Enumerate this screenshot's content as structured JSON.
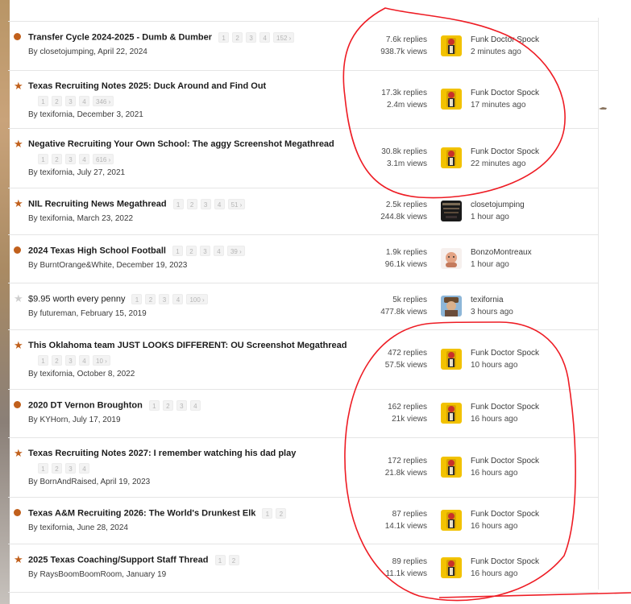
{
  "threads": [
    {
      "title": "Transfer Cycle 2024-2025 - Dumb & Dumber",
      "pages": [
        "1",
        "2",
        "3",
        "4",
        "152 ›"
      ],
      "byline": "By closetojumping, April 22, 2024",
      "replies": "7.6k replies",
      "views": "938.7k views",
      "last_user": "Funk Doctor Spock",
      "last_time": "2 minutes ago",
      "status": "dot"
    },
    {
      "title": "Texas Recruiting Notes 2025: Duck Around and Find Out",
      "pages": [
        "1",
        "2",
        "3",
        "4",
        "346 ›"
      ],
      "byline": "By texifornia, December 3, 2021",
      "replies": "17.3k replies",
      "views": "2.4m views",
      "last_user": "Funk Doctor Spock",
      "last_time": "17 minutes ago",
      "status": "star"
    },
    {
      "title": "Negative Recruiting Your Own School: The aggy Screenshot Megathread",
      "pages": [
        "1",
        "2",
        "3",
        "4",
        "616 ›"
      ],
      "byline": "By texifornia, July 27, 2021",
      "replies": "30.8k replies",
      "views": "3.1m views",
      "last_user": "Funk Doctor Spock",
      "last_time": "22 minutes ago",
      "status": "star"
    },
    {
      "title": "NIL Recruiting News Megathread",
      "pages": [
        "1",
        "2",
        "3",
        "4",
        "51 ›"
      ],
      "byline": "By texifornia, March 23, 2022",
      "replies": "2.5k replies",
      "views": "244.8k views",
      "last_user": "closetojumping",
      "last_time": "1 hour ago",
      "status": "star"
    },
    {
      "title": "2024 Texas High School Football",
      "pages": [
        "1",
        "2",
        "3",
        "4",
        "39 ›"
      ],
      "byline": "By BurntOrange&White, December 19, 2023",
      "replies": "1.9k replies",
      "views": "96.1k views",
      "last_user": "BonzoMontreaux",
      "last_time": "1 hour ago",
      "status": "dot"
    },
    {
      "title": "$9.95 worth every penny",
      "pages": [
        "1",
        "2",
        "3",
        "4",
        "100 ›"
      ],
      "byline": "By futureman, February 15, 2019",
      "replies": "5k replies",
      "views": "477.8k views",
      "last_user": "texifornia",
      "last_time": "3 hours ago",
      "status": "star-gray"
    },
    {
      "title": "This Oklahoma team JUST LOOKS DIFFERENT: OU Screenshot Megathread",
      "pages": [
        "1",
        "2",
        "3",
        "4",
        "10 ›"
      ],
      "byline": "By texifornia, October 8, 2022",
      "replies": "472 replies",
      "views": "57.5k views",
      "last_user": "Funk Doctor Spock",
      "last_time": "10 hours ago",
      "status": "star"
    },
    {
      "title": "2020 DT Vernon Broughton",
      "pages": [
        "1",
        "2",
        "3",
        "4"
      ],
      "byline": "By KYHorn, July 17, 2019",
      "replies": "162 replies",
      "views": "21k views",
      "last_user": "Funk Doctor Spock",
      "last_time": "16 hours ago",
      "status": "dot"
    },
    {
      "title": "Texas Recruiting Notes 2027: I remember watching his dad play",
      "pages": [
        "1",
        "2",
        "3",
        "4"
      ],
      "byline": "By BornAndRaised, April 19, 2023",
      "replies": "172 replies",
      "views": "21.8k views",
      "last_user": "Funk Doctor Spock",
      "last_time": "16 hours ago",
      "status": "star"
    },
    {
      "title": "Texas A&M Recruiting 2026: The World's Drunkest Elk",
      "pages": [
        "1",
        "2"
      ],
      "byline": "By texifornia, June 28, 2024",
      "replies": "87 replies",
      "views": "14.1k views",
      "last_user": "Funk Doctor Spock",
      "last_time": "16 hours ago",
      "status": "dot"
    },
    {
      "title": "2025 Texas Coaching/Support Staff Thread",
      "pages": [
        "1",
        "2"
      ],
      "byline": "By RaysBoomBoomRoom, January 19",
      "replies": "89 replies",
      "views": "11.1k views",
      "last_user": "Funk Doctor Spock",
      "last_time": "16 hours ago",
      "status": "star"
    }
  ],
  "colors": {
    "accent": "#c1601c",
    "annotation": "#ee1c24",
    "star_inactive": "#cfcfcf"
  },
  "icons": {
    "dot": "unread-dot-icon",
    "star": "featured-star-icon",
    "star-gray": "read-star-icon"
  }
}
